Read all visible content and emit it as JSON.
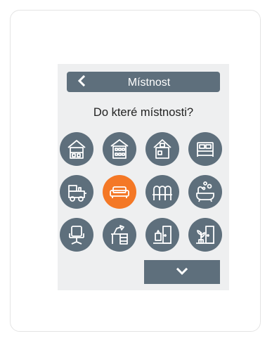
{
  "header": {
    "title": "Místnost",
    "back_icon": "chevron-left-icon"
  },
  "prompt": "Do které místnosti?",
  "colors": {
    "tile": "#5e6f7c",
    "selected": "#f47826",
    "panel": "#eeeff0",
    "icon": "#ffffff"
  },
  "rooms": [
    {
      "icon": "building-small-icon",
      "selected": false
    },
    {
      "icon": "building-medium-icon",
      "selected": false
    },
    {
      "icon": "house-attic-icon",
      "selected": false
    },
    {
      "icon": "bed-icon",
      "selected": false
    },
    {
      "icon": "toy-train-icon",
      "selected": false
    },
    {
      "icon": "sofa-icon",
      "selected": true
    },
    {
      "icon": "dining-chairs-icon",
      "selected": false
    },
    {
      "icon": "bathtub-icon",
      "selected": false
    },
    {
      "icon": "office-chair-icon",
      "selected": false
    },
    {
      "icon": "desk-lamp-icon",
      "selected": false
    },
    {
      "icon": "hallway-door-icon",
      "selected": false
    },
    {
      "icon": "door-plant-icon",
      "selected": false
    }
  ],
  "more_button": {
    "icon": "chevron-down-icon"
  }
}
